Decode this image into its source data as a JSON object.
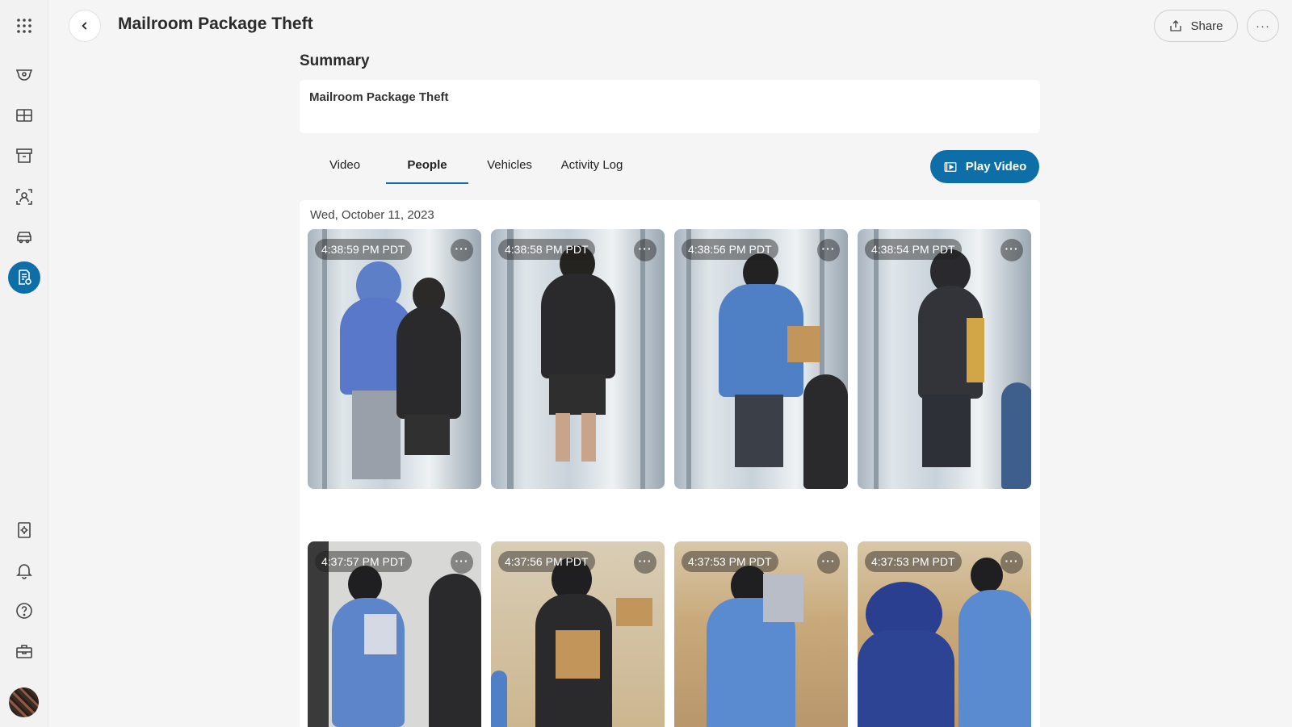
{
  "sidebar": {
    "icons": [
      "apps-grid-icon",
      "camera-dome-icon",
      "layout-grid-icon",
      "archive-icon",
      "person-scan-icon",
      "vehicle-icon",
      "case-document-icon",
      "settings-document-icon",
      "bell-icon",
      "help-icon",
      "toolbox-icon"
    ],
    "active": "case-document-icon"
  },
  "header": {
    "title": "Mailroom Package Theft",
    "share_label": "Share",
    "more_label": "···"
  },
  "summary": {
    "heading": "Summary",
    "text": "Mailroom Package Theft"
  },
  "tabs": [
    {
      "label": "Video",
      "active": false
    },
    {
      "label": "People",
      "active": true
    },
    {
      "label": "Vehicles",
      "active": false
    },
    {
      "label": "Activity Log",
      "active": false
    }
  ],
  "play_video_label": "Play Video",
  "date": "Wed, October 11, 2023",
  "thumbnails": [
    {
      "timestamp": "4:38:59 PM PDT"
    },
    {
      "timestamp": "4:38:58 PM PDT"
    },
    {
      "timestamp": "4:38:56 PM PDT"
    },
    {
      "timestamp": "4:38:54 PM PDT"
    },
    {
      "timestamp": "4:37:57 PM PDT"
    },
    {
      "timestamp": "4:37:56 PM PDT"
    },
    {
      "timestamp": "4:37:53 PM PDT"
    },
    {
      "timestamp": "4:37:53 PM PDT"
    }
  ],
  "thumb_menu_label": "···",
  "colors": {
    "accent": "#0d6ea8",
    "background": "#f5f5f5",
    "panel": "#ffffff"
  }
}
